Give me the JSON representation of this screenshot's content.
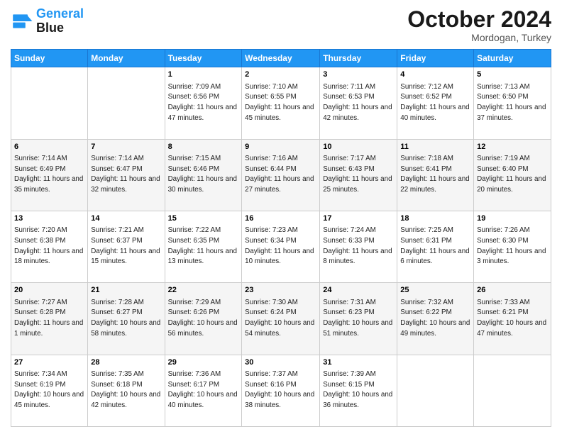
{
  "logo": {
    "line1": "General",
    "line2": "Blue"
  },
  "header": {
    "month": "October 2024",
    "location": "Mordogan, Turkey"
  },
  "days_of_week": [
    "Sunday",
    "Monday",
    "Tuesday",
    "Wednesday",
    "Thursday",
    "Friday",
    "Saturday"
  ],
  "weeks": [
    [
      null,
      null,
      {
        "day": 1,
        "sunrise": "7:09 AM",
        "sunset": "6:56 PM",
        "daylight": "11 hours and 47 minutes."
      },
      {
        "day": 2,
        "sunrise": "7:10 AM",
        "sunset": "6:55 PM",
        "daylight": "11 hours and 45 minutes."
      },
      {
        "day": 3,
        "sunrise": "7:11 AM",
        "sunset": "6:53 PM",
        "daylight": "11 hours and 42 minutes."
      },
      {
        "day": 4,
        "sunrise": "7:12 AM",
        "sunset": "6:52 PM",
        "daylight": "11 hours and 40 minutes."
      },
      {
        "day": 5,
        "sunrise": "7:13 AM",
        "sunset": "6:50 PM",
        "daylight": "11 hours and 37 minutes."
      }
    ],
    [
      {
        "day": 6,
        "sunrise": "7:14 AM",
        "sunset": "6:49 PM",
        "daylight": "11 hours and 35 minutes."
      },
      {
        "day": 7,
        "sunrise": "7:14 AM",
        "sunset": "6:47 PM",
        "daylight": "11 hours and 32 minutes."
      },
      {
        "day": 8,
        "sunrise": "7:15 AM",
        "sunset": "6:46 PM",
        "daylight": "11 hours and 30 minutes."
      },
      {
        "day": 9,
        "sunrise": "7:16 AM",
        "sunset": "6:44 PM",
        "daylight": "11 hours and 27 minutes."
      },
      {
        "day": 10,
        "sunrise": "7:17 AM",
        "sunset": "6:43 PM",
        "daylight": "11 hours and 25 minutes."
      },
      {
        "day": 11,
        "sunrise": "7:18 AM",
        "sunset": "6:41 PM",
        "daylight": "11 hours and 22 minutes."
      },
      {
        "day": 12,
        "sunrise": "7:19 AM",
        "sunset": "6:40 PM",
        "daylight": "11 hours and 20 minutes."
      }
    ],
    [
      {
        "day": 13,
        "sunrise": "7:20 AM",
        "sunset": "6:38 PM",
        "daylight": "11 hours and 18 minutes."
      },
      {
        "day": 14,
        "sunrise": "7:21 AM",
        "sunset": "6:37 PM",
        "daylight": "11 hours and 15 minutes."
      },
      {
        "day": 15,
        "sunrise": "7:22 AM",
        "sunset": "6:35 PM",
        "daylight": "11 hours and 13 minutes."
      },
      {
        "day": 16,
        "sunrise": "7:23 AM",
        "sunset": "6:34 PM",
        "daylight": "11 hours and 10 minutes."
      },
      {
        "day": 17,
        "sunrise": "7:24 AM",
        "sunset": "6:33 PM",
        "daylight": "11 hours and 8 minutes."
      },
      {
        "day": 18,
        "sunrise": "7:25 AM",
        "sunset": "6:31 PM",
        "daylight": "11 hours and 6 minutes."
      },
      {
        "day": 19,
        "sunrise": "7:26 AM",
        "sunset": "6:30 PM",
        "daylight": "11 hours and 3 minutes."
      }
    ],
    [
      {
        "day": 20,
        "sunrise": "7:27 AM",
        "sunset": "6:28 PM",
        "daylight": "11 hours and 1 minute."
      },
      {
        "day": 21,
        "sunrise": "7:28 AM",
        "sunset": "6:27 PM",
        "daylight": "10 hours and 58 minutes."
      },
      {
        "day": 22,
        "sunrise": "7:29 AM",
        "sunset": "6:26 PM",
        "daylight": "10 hours and 56 minutes."
      },
      {
        "day": 23,
        "sunrise": "7:30 AM",
        "sunset": "6:24 PM",
        "daylight": "10 hours and 54 minutes."
      },
      {
        "day": 24,
        "sunrise": "7:31 AM",
        "sunset": "6:23 PM",
        "daylight": "10 hours and 51 minutes."
      },
      {
        "day": 25,
        "sunrise": "7:32 AM",
        "sunset": "6:22 PM",
        "daylight": "10 hours and 49 minutes."
      },
      {
        "day": 26,
        "sunrise": "7:33 AM",
        "sunset": "6:21 PM",
        "daylight": "10 hours and 47 minutes."
      }
    ],
    [
      {
        "day": 27,
        "sunrise": "7:34 AM",
        "sunset": "6:19 PM",
        "daylight": "10 hours and 45 minutes."
      },
      {
        "day": 28,
        "sunrise": "7:35 AM",
        "sunset": "6:18 PM",
        "daylight": "10 hours and 42 minutes."
      },
      {
        "day": 29,
        "sunrise": "7:36 AM",
        "sunset": "6:17 PM",
        "daylight": "10 hours and 40 minutes."
      },
      {
        "day": 30,
        "sunrise": "7:37 AM",
        "sunset": "6:16 PM",
        "daylight": "10 hours and 38 minutes."
      },
      {
        "day": 31,
        "sunrise": "7:39 AM",
        "sunset": "6:15 PM",
        "daylight": "10 hours and 36 minutes."
      },
      null,
      null
    ]
  ]
}
